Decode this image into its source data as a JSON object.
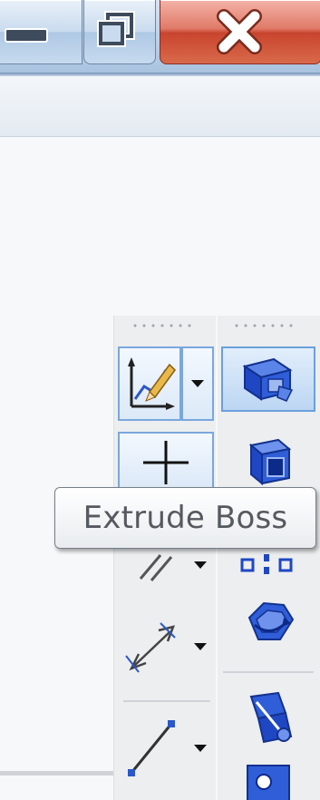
{
  "window": {
    "minimize_icon": "minimize-icon",
    "restore_icon": "restore-icon",
    "close_icon": "close-icon"
  },
  "tooltip": {
    "text": "Extrude Boss"
  },
  "toolbar_left": {
    "tools": [
      {
        "name": "sketch",
        "icon": "sketch-icon",
        "has_dropdown": true
      },
      {
        "name": "line-cross",
        "icon": "plus-icon",
        "has_dropdown": false
      },
      {
        "name": "parallel",
        "icon": "parallel-lines-icon",
        "has_dropdown": true
      },
      {
        "name": "smart-dimension",
        "icon": "dimension-icon",
        "has_dropdown": true
      },
      {
        "name": "line",
        "icon": "line-icon",
        "has_dropdown": true
      }
    ]
  },
  "toolbar_right": {
    "tools": [
      {
        "name": "extrude-boss",
        "icon": "extrude-boss-icon"
      },
      {
        "name": "extrude-cut",
        "icon": "extrude-cut-icon"
      },
      {
        "name": "linear-pattern",
        "icon": "pattern-icon"
      },
      {
        "name": "revolve",
        "icon": "revolve-icon"
      },
      {
        "name": "sweep",
        "icon": "sweep-icon"
      },
      {
        "name": "hole",
        "icon": "hole-icon"
      }
    ]
  },
  "colors": {
    "titlebar": "#bed4ea",
    "close_button": "#c9442e",
    "highlight_border": "#7aa7dd",
    "icon_blue": "#1f47c4"
  }
}
